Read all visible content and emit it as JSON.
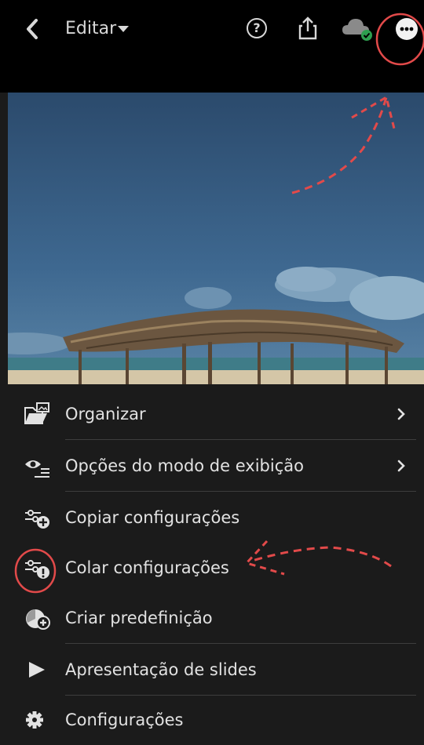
{
  "header": {
    "title": "Editar",
    "icons": [
      "back-icon",
      "caret-down-icon",
      "help-icon",
      "share-icon",
      "cloud-synced-icon",
      "more-options-icon"
    ]
  },
  "menu": {
    "items": [
      {
        "label": "Organizar",
        "icon": "organize-folder-icon",
        "has_submenu": true
      },
      {
        "label": "Opções do modo de exibição",
        "icon": "view-options-icon",
        "has_submenu": true
      },
      {
        "label": "Copiar configurações",
        "icon": "copy-settings-icon",
        "has_submenu": false
      },
      {
        "label": "Colar configurações",
        "icon": "paste-settings-icon",
        "has_submenu": false
      },
      {
        "label": "Criar predefinição",
        "icon": "create-preset-icon",
        "has_submenu": false
      },
      {
        "label": "Apresentação de slides",
        "icon": "play-icon",
        "has_submenu": false
      },
      {
        "label": "Configurações",
        "icon": "gear-icon",
        "has_submenu": false
      }
    ]
  },
  "colors": {
    "background": "#000000",
    "menu_background": "#1b1b1b",
    "text": "#e2e2e2",
    "annotation": "#e24a4a",
    "synced_badge": "#2e9e4f"
  }
}
